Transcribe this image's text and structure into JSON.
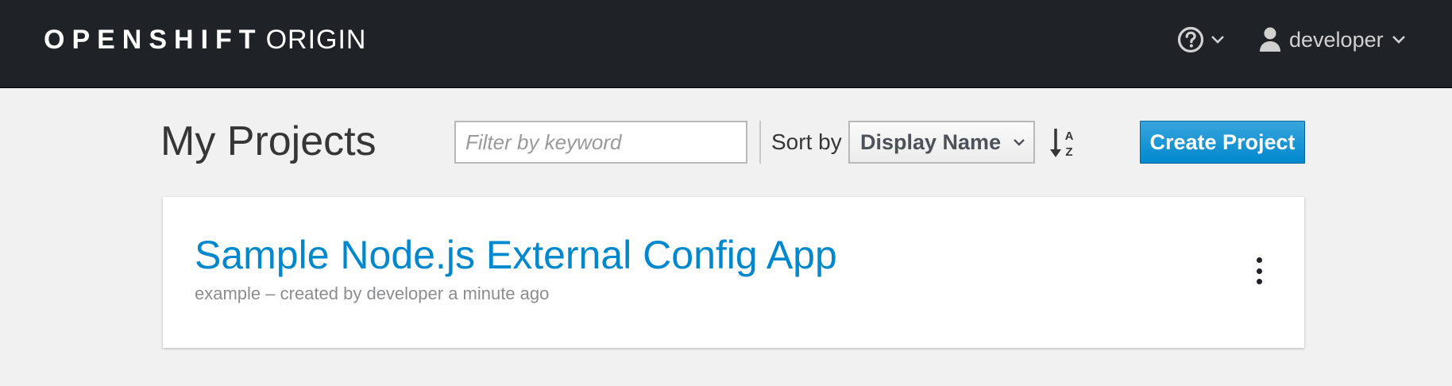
{
  "navbar": {
    "brand_strong": "OPENSHIFT",
    "brand_light": "ORIGIN",
    "help_icon": "question-circle-icon",
    "user_icon": "user-icon",
    "username": "developer"
  },
  "toolbar": {
    "title": "My Projects",
    "filter_placeholder": "Filter by keyword",
    "filter_value": "",
    "sort_label": "Sort by",
    "sort_value": "Display Name",
    "sort_direction_icon": "sort-alpha-asc-icon",
    "create_label": "Create Project"
  },
  "projects": [
    {
      "display_name": "Sample Node.js External Config App",
      "meta": "example – created by developer a minute ago"
    }
  ],
  "colors": {
    "navbar_bg": "#1f2328",
    "page_bg": "#f1f1f1",
    "link_blue": "#0088ce",
    "primary_button": "#0088ce"
  }
}
